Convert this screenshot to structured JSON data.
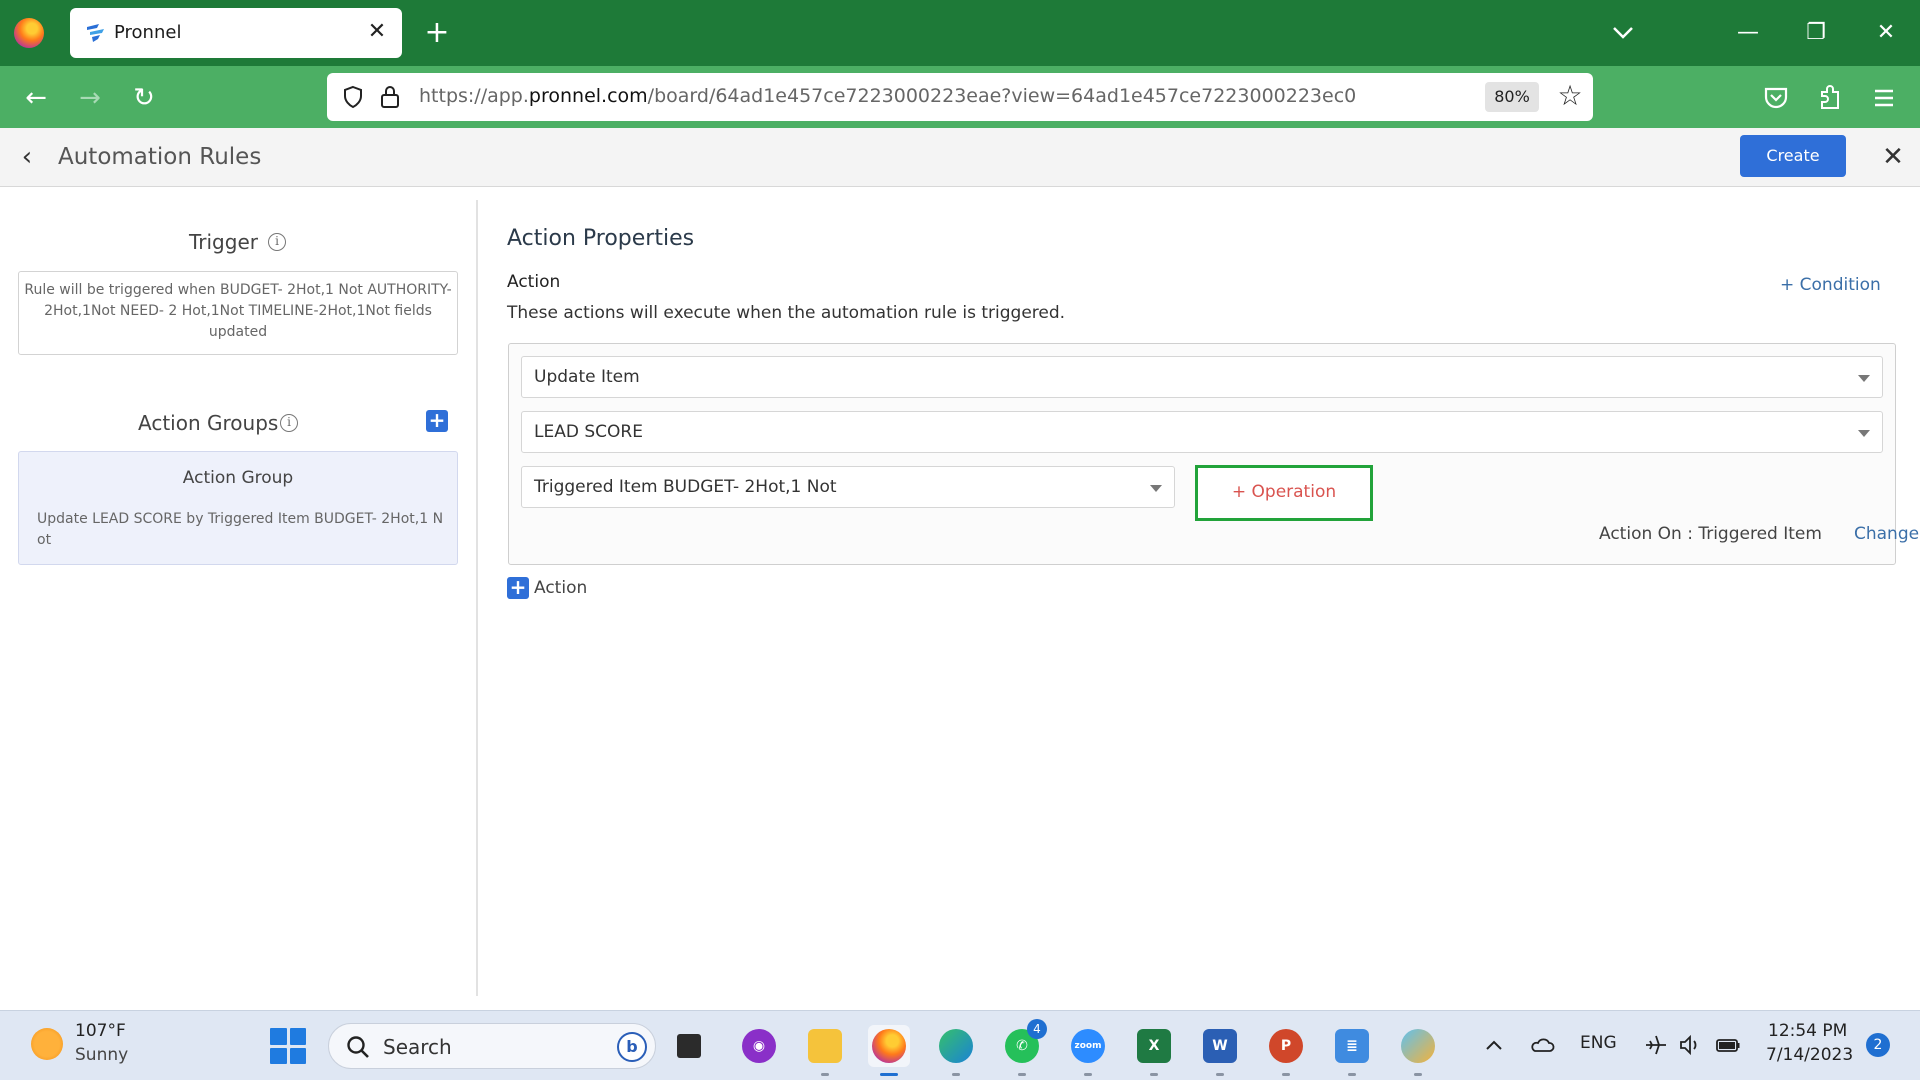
{
  "browser": {
    "tab_title": "Pronnel",
    "url_prefix": "https://app.",
    "url_host": "pronnel.com",
    "url_path": "/board/64ad1e457ce7223000223eae?view=64ad1e457ce7223000223ec0",
    "zoom": "80%"
  },
  "header": {
    "title": "Automation Rules",
    "create_label": "Create"
  },
  "trigger": {
    "title": "Trigger",
    "description": "Rule will be triggered when BUDGET- 2Hot,1 Not AUTHORITY- 2Hot,1Not NEED- 2 Hot,1Not TIMELINE-2Hot,1Not fields updated"
  },
  "action_groups": {
    "title": "Action Groups",
    "items": [
      {
        "title": "Action Group",
        "description": "Update LEAD SCORE by Triggered Item BUDGET- 2Hot,1 Not"
      }
    ]
  },
  "action_properties": {
    "title": "Action Properties",
    "action_label": "Action",
    "description": "These actions will execute when the automation rule is triggered.",
    "condition_link": "+ Condition",
    "action_type": "Update Item",
    "field": "LEAD SCORE",
    "value_source": "Triggered Item BUDGET- 2Hot,1 Not",
    "operation_label": "+ Operation",
    "action_on": "Action On : Triggered Item",
    "change_link": "Change",
    "add_action_label": "Action"
  },
  "taskbar": {
    "weather_temp": "107°F",
    "weather_cond": "Sunny",
    "search_placeholder": "Search",
    "whatsapp_badge": "4",
    "zoom_label": "zoom",
    "excel_label": "X",
    "word_label": "W",
    "ppt_label": "P",
    "language": "ENG",
    "time": "12:54 PM",
    "date": "7/14/2023",
    "notifications": "2"
  },
  "colors": {
    "tabbar": "#1e7a38",
    "navbar": "#4caf64",
    "primary": "#2f6fd8",
    "operation_border": "#22a33a",
    "operation_text": "#d9534f",
    "link": "#3b6fa8"
  }
}
